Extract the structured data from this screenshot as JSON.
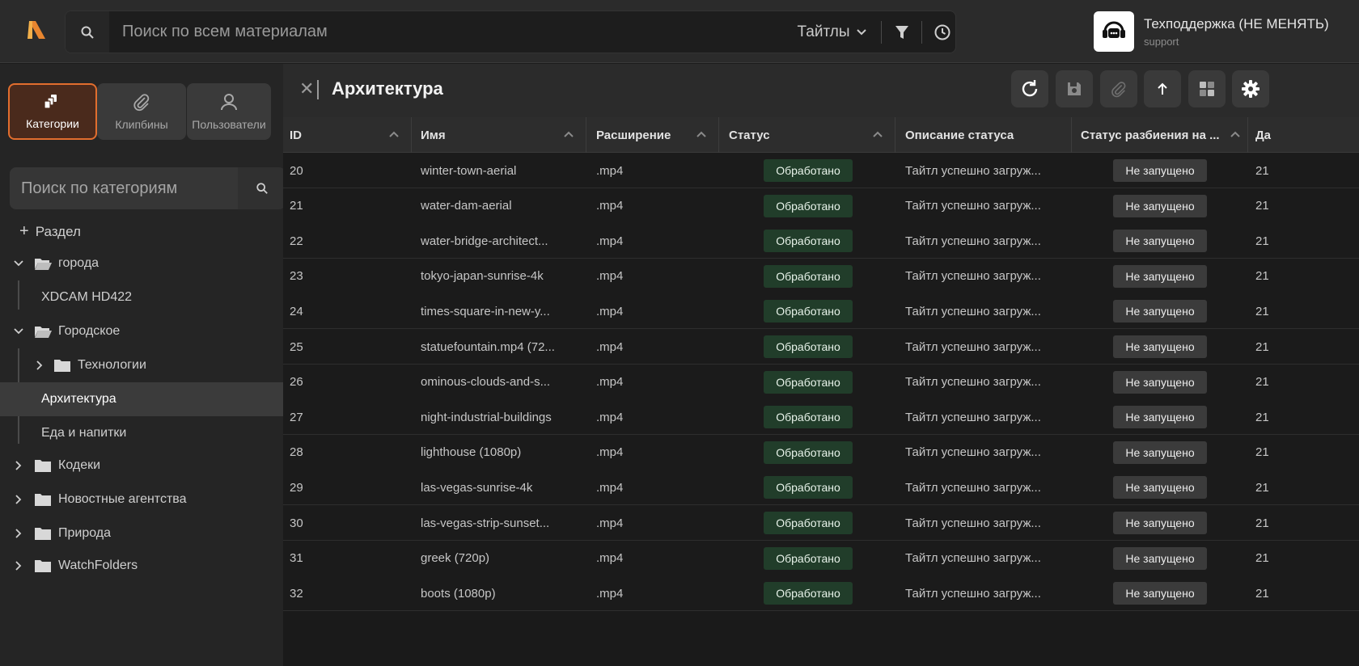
{
  "topbar": {
    "search_placeholder": "Поиск по всем материалам",
    "scope_label": "Тайтлы",
    "support_name": "Техподдержка (НЕ МЕНЯТЬ)",
    "support_sub": "support",
    "accent": "#e26e2e"
  },
  "sidebar": {
    "tabs": [
      {
        "label": "Категории",
        "icon": "layers-icon",
        "active": true
      },
      {
        "label": "Клипбины",
        "icon": "paperclip-icon",
        "active": false
      },
      {
        "label": "Пользователи",
        "icon": "user-icon",
        "active": false
      }
    ],
    "search_placeholder": "Поиск по категориям",
    "add_section": "Раздел",
    "tree": [
      {
        "label": "города",
        "expanded": true,
        "folder": true
      },
      {
        "label": "XDCAM HD422",
        "folder": false
      },
      {
        "label": "Городское",
        "expanded": true,
        "folder": true
      },
      {
        "label": "Технологии",
        "expanded": false,
        "folder": true
      },
      {
        "label": "Архитектура",
        "folder": false,
        "selected": true
      },
      {
        "label": "Еда и напитки",
        "folder": false
      },
      {
        "label": "Кодеки",
        "expanded": false,
        "folder": true
      },
      {
        "label": "Новостные агентства",
        "expanded": false,
        "folder": true
      },
      {
        "label": "Природа",
        "expanded": false,
        "folder": true
      },
      {
        "label": "WatchFolders",
        "expanded": false,
        "folder": true
      }
    ]
  },
  "main": {
    "title": "Архитектура",
    "columns": [
      "ID",
      "Имя",
      "Расширение",
      "Статус",
      "Описание статуса",
      "Статус разбиения на ...",
      "Да"
    ],
    "rows": [
      {
        "id": "20",
        "name": "winter-town-aerial",
        "ext": ".mp4",
        "status": "Обработано",
        "desc": "Тайтл успешно загруж...",
        "split": "Не запущено",
        "date": "21"
      },
      {
        "id": "21",
        "name": "water-dam-aerial",
        "ext": ".mp4",
        "status": "Обработано",
        "desc": "Тайтл успешно загруж...",
        "split": "Не запущено",
        "date": "21"
      },
      {
        "id": "22",
        "name": "water-bridge-architect...",
        "ext": ".mp4",
        "status": "Обработано",
        "desc": "Тайтл успешно загруж...",
        "split": "Не запущено",
        "date": "21"
      },
      {
        "id": "23",
        "name": "tokyo-japan-sunrise-4k",
        "ext": ".mp4",
        "status": "Обработано",
        "desc": "Тайтл успешно загруж...",
        "split": "Не запущено",
        "date": "21"
      },
      {
        "id": "24",
        "name": "times-square-in-new-y...",
        "ext": ".mp4",
        "status": "Обработано",
        "desc": "Тайтл успешно загруж...",
        "split": "Не запущено",
        "date": "21"
      },
      {
        "id": "25",
        "name": "statuefountain.mp4 (72...",
        "ext": ".mp4",
        "status": "Обработано",
        "desc": "Тайтл успешно загруж...",
        "split": "Не запущено",
        "date": "21"
      },
      {
        "id": "26",
        "name": "ominous-clouds-and-s...",
        "ext": ".mp4",
        "status": "Обработано",
        "desc": "Тайтл успешно загруж...",
        "split": "Не запущено",
        "date": "21"
      },
      {
        "id": "27",
        "name": "night-industrial-buildings",
        "ext": ".mp4",
        "status": "Обработано",
        "desc": "Тайтл успешно загруж...",
        "split": "Не запущено",
        "date": "21"
      },
      {
        "id": "28",
        "name": "lighthouse (1080p)",
        "ext": ".mp4",
        "status": "Обработано",
        "desc": "Тайтл успешно загруж...",
        "split": "Не запущено",
        "date": "21"
      },
      {
        "id": "29",
        "name": "las-vegas-sunrise-4k",
        "ext": ".mp4",
        "status": "Обработано",
        "desc": "Тайтл успешно загруж...",
        "split": "Не запущено",
        "date": "21"
      },
      {
        "id": "30",
        "name": "las-vegas-strip-sunset...",
        "ext": ".mp4",
        "status": "Обработано",
        "desc": "Тайтл успешно загруж...",
        "split": "Не запущено",
        "date": "21"
      },
      {
        "id": "31",
        "name": "greek (720p)",
        "ext": ".mp4",
        "status": "Обработано",
        "desc": "Тайтл успешно загруж...",
        "split": "Не запущено",
        "date": "21"
      },
      {
        "id": "32",
        "name": "boots (1080p)",
        "ext": ".mp4",
        "status": "Обработано",
        "desc": "Тайтл успешно загруж...",
        "split": "Не запущено",
        "date": "21"
      }
    ]
  }
}
